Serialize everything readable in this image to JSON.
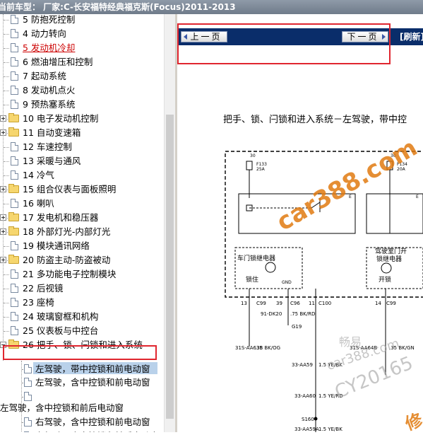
{
  "window": {
    "title": "当前车型：  厂家:C-长安福特经典福克斯(Focus)2011-2013"
  },
  "tree": {
    "items": [
      {
        "label": "5 防抱死控制",
        "type": "doc"
      },
      {
        "label": "4 动力转向",
        "type": "doc"
      },
      {
        "label": "5 发动机冷却",
        "type": "doc",
        "highlight": true
      },
      {
        "label": "6 燃油增压和控制",
        "type": "doc"
      },
      {
        "label": "7 起动系统",
        "type": "doc"
      },
      {
        "label": "8 发动机点火",
        "type": "doc"
      },
      {
        "label": "9 预热塞系统",
        "type": "doc"
      },
      {
        "label": "10 电子发动机控制",
        "type": "folder"
      },
      {
        "label": "11 自动变速箱",
        "type": "folder"
      },
      {
        "label": "12 车速控制",
        "type": "doc"
      },
      {
        "label": "13 采暖与通风",
        "type": "doc"
      },
      {
        "label": "14 冷气",
        "type": "doc"
      },
      {
        "label": "15 组合仪表与面板照明",
        "type": "folder"
      },
      {
        "label": "16 喇叭",
        "type": "doc"
      },
      {
        "label": "17 发电机和稳压器",
        "type": "folder"
      },
      {
        "label": "18 外部灯光-内部灯光",
        "type": "folder"
      },
      {
        "label": "19 模块通讯网络",
        "type": "doc"
      },
      {
        "label": "20 防盗主动-防盗被动",
        "type": "folder"
      },
      {
        "label": "21 多功能电子控制模块",
        "type": "doc"
      },
      {
        "label": "22 后视镜",
        "type": "doc"
      },
      {
        "label": "23 座椅",
        "type": "doc"
      },
      {
        "label": "24 玻璃窗框和机构",
        "type": "doc"
      },
      {
        "label": "25 仪表板与中控台",
        "type": "doc"
      },
      {
        "label": "26 把手、锁、闩锁和进入系统",
        "type": "folder-open"
      }
    ],
    "children": [
      {
        "label": "左驾驶，带中控锁和前电动窗",
        "selected": true
      },
      {
        "label": "左驾驶，含中控锁和前电动窗"
      },
      {
        "label": ""
      },
      {
        "label": "左驾驶，含中控锁和前后电动窗"
      },
      {
        "label": "右驾驶，含中控锁和前电动窗"
      },
      {
        "label": "右驾驶，含中控锁和前后电动窗"
      }
    ]
  },
  "nav": {
    "prev_label": "上一页",
    "next_label": "下一页",
    "refresh_label": "[刷新]"
  },
  "diagram": {
    "title": "把手、锁、闩锁和进入系统－左驾驶，带中控",
    "fuse1": {
      "id": "F133",
      "rating": "25A",
      "num": "30"
    },
    "fuse2": {
      "id": "F134",
      "rating": "20A",
      "num": "30"
    },
    "relay1": {
      "label": "车门锁继电器",
      "sub": "锁住",
      "gnd": "GND"
    },
    "relay2": {
      "label1": "驾驶室门开",
      "label2": "锁继电器",
      "sub": "开锁"
    },
    "e_left": "E",
    "e_right": "E",
    "pins": [
      "13",
      "C99",
      "39",
      "C96",
      "11",
      "C100",
      "14",
      "C99"
    ],
    "wires": [
      "91-DK20",
      ".75 BK/RD",
      "G19",
      "31S-AA63B",
      ".35 BK/OG",
      "31S-AA64B",
      ".35 BK/GN",
      "33-AA59",
      "1.5 YE/BK",
      "33-AA60",
      "1.5 YE/RD",
      "S160",
      "33-AA59A",
      "1.5 YE/BK"
    ]
  },
  "watermarks": {
    "main": "car388.com",
    "brand1": "畅易",
    "brand2": "car388.com",
    "brand3": "CY20165",
    "brand4": "修"
  },
  "colors": {
    "nav_bg": "#0a2d6a",
    "highlight_red": "#e0262f",
    "selection_blue": "#b9d1ea",
    "watermark_orange": "#e07a10"
  }
}
